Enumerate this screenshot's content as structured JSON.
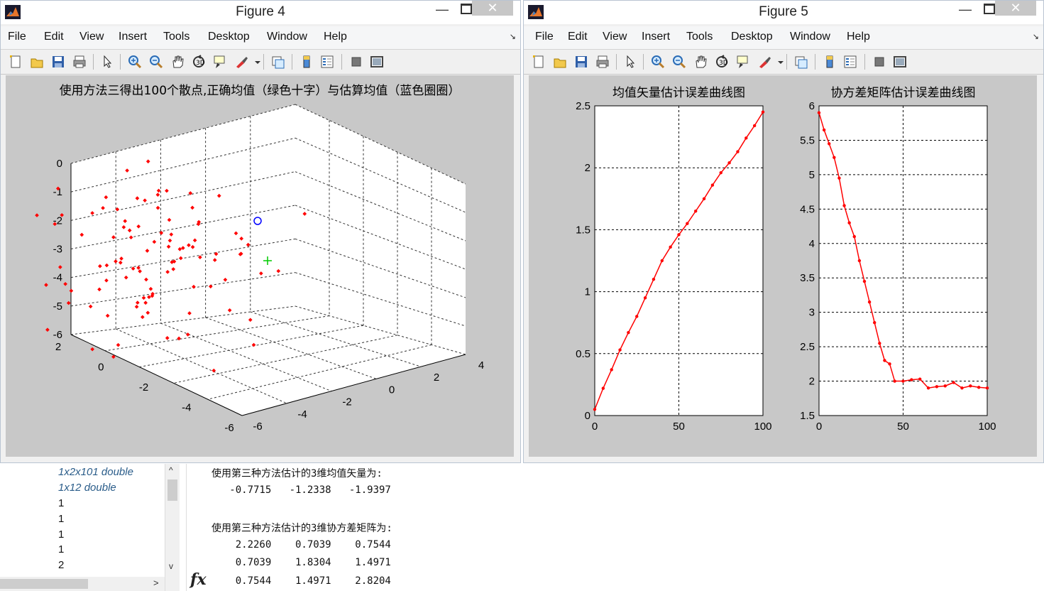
{
  "fig4": {
    "title": "Figure 4",
    "menu": [
      "File",
      "Edit",
      "View",
      "Insert",
      "Tools",
      "Desktop",
      "Window",
      "Help"
    ],
    "close_glyph": "✕",
    "min_glyph": "—",
    "dock_glyph": "↘",
    "toolbar_icons": [
      "new-figure-icon",
      "open-file-icon",
      "save-icon",
      "print-icon",
      "edit-plot-icon",
      "zoom-in-icon",
      "zoom-out-icon",
      "pan-icon",
      "rotate-3d-icon",
      "data-cursor-icon",
      "brush-icon",
      "brush-dropdown-icon",
      "link-plot-icon",
      "insert-colorbar-icon",
      "insert-legend-icon",
      "hide-plot-tools-icon",
      "show-plot-tools-icon"
    ],
    "plot": {
      "title": "使用方法三得出100个散点,正确均值（绿色十字）与估算均值（蓝色圈圈）",
      "zticks": [
        "0",
        "-1",
        "-2",
        "-3",
        "-4",
        "-5",
        "-6"
      ],
      "xticks": [
        "-6",
        "-4",
        "-2",
        "0",
        "2",
        "4"
      ],
      "yticks": [
        "2",
        "0",
        "-2",
        "-4",
        "-6"
      ],
      "colors": {
        "points": "#ff0000",
        "true_mean": "#00cc00",
        "est_mean": "#0000ff",
        "bg": "#ffffff",
        "grid": "#333333"
      }
    }
  },
  "fig5": {
    "title": "Figure 5",
    "menu": [
      "File",
      "Edit",
      "View",
      "Insert",
      "Tools",
      "Desktop",
      "Window",
      "Help"
    ],
    "close_glyph": "✕",
    "min_glyph": "—",
    "dock_glyph": "↘",
    "toolbar_icons": [
      "new-figure-icon",
      "open-file-icon",
      "save-icon",
      "print-icon",
      "edit-plot-icon",
      "zoom-in-icon",
      "zoom-out-icon",
      "pan-icon",
      "rotate-3d-icon",
      "data-cursor-icon",
      "brush-icon",
      "brush-dropdown-icon",
      "link-plot-icon",
      "insert-colorbar-icon",
      "insert-legend-icon",
      "hide-plot-tools-icon",
      "show-plot-tools-icon"
    ]
  },
  "chart_data": [
    {
      "type": "line",
      "title": "均值矢量估计误差曲线图",
      "xlabel": "",
      "ylabel": "",
      "xlim": [
        0,
        100
      ],
      "ylim": [
        0,
        2.5
      ],
      "xticks": [
        0,
        50,
        100
      ],
      "yticks": [
        0,
        0.5,
        1,
        1.5,
        2,
        2.5
      ],
      "grid": true,
      "color": "#ff0000",
      "series": [
        {
          "x": [
            0,
            5,
            10,
            15,
            20,
            25,
            30,
            35,
            40,
            45,
            50,
            55,
            60,
            65,
            70,
            75,
            80,
            85,
            90,
            95,
            100
          ],
          "y": [
            0.05,
            0.22,
            0.37,
            0.53,
            0.67,
            0.8,
            0.95,
            1.1,
            1.25,
            1.36,
            1.46,
            1.55,
            1.65,
            1.75,
            1.86,
            1.96,
            2.04,
            2.13,
            2.24,
            2.34,
            2.45
          ]
        }
      ]
    },
    {
      "type": "line",
      "title": "协方差矩阵估计误差曲线图",
      "xlabel": "",
      "ylabel": "",
      "xlim": [
        0,
        100
      ],
      "ylim": [
        1.5,
        6
      ],
      "xticks": [
        0,
        50,
        100
      ],
      "yticks": [
        1.5,
        2,
        2.5,
        3,
        3.5,
        4,
        4.5,
        5,
        5.5,
        6
      ],
      "grid": true,
      "color": "#ff0000",
      "series": [
        {
          "x": [
            0,
            3,
            6,
            9,
            12,
            15,
            18,
            21,
            24,
            27,
            30,
            33,
            36,
            39,
            42,
            45,
            50,
            55,
            60,
            65,
            70,
            75,
            80,
            85,
            90,
            95,
            100
          ],
          "y": [
            5.9,
            5.65,
            5.45,
            5.25,
            4.95,
            4.55,
            4.3,
            4.1,
            3.75,
            3.45,
            3.15,
            2.85,
            2.55,
            2.3,
            2.25,
            2.0,
            2.0,
            2.02,
            2.03,
            1.9,
            1.92,
            1.93,
            1.98,
            1.9,
            1.93,
            1.91,
            1.9
          ]
        }
      ]
    }
  ],
  "workspace": {
    "values": [
      "1x2x101 double",
      "1x12 double",
      "1",
      "1",
      "1",
      "1",
      "2"
    ],
    "scroll_up": "^",
    "scroll_down": "v",
    "scroll_right": ">"
  },
  "command_window": {
    "lines": [
      "使用第三种方法估计的3维均值矢量为:",
      "   -0.7715   -1.2338   -1.9397",
      "",
      "使用第三种方法估计的3维协方差矩阵为:",
      "    2.2260    0.7039    0.7544",
      "    0.7039    1.8304    1.4971",
      "    0.7544    1.4971    2.8204"
    ],
    "fx_label": "fx"
  }
}
